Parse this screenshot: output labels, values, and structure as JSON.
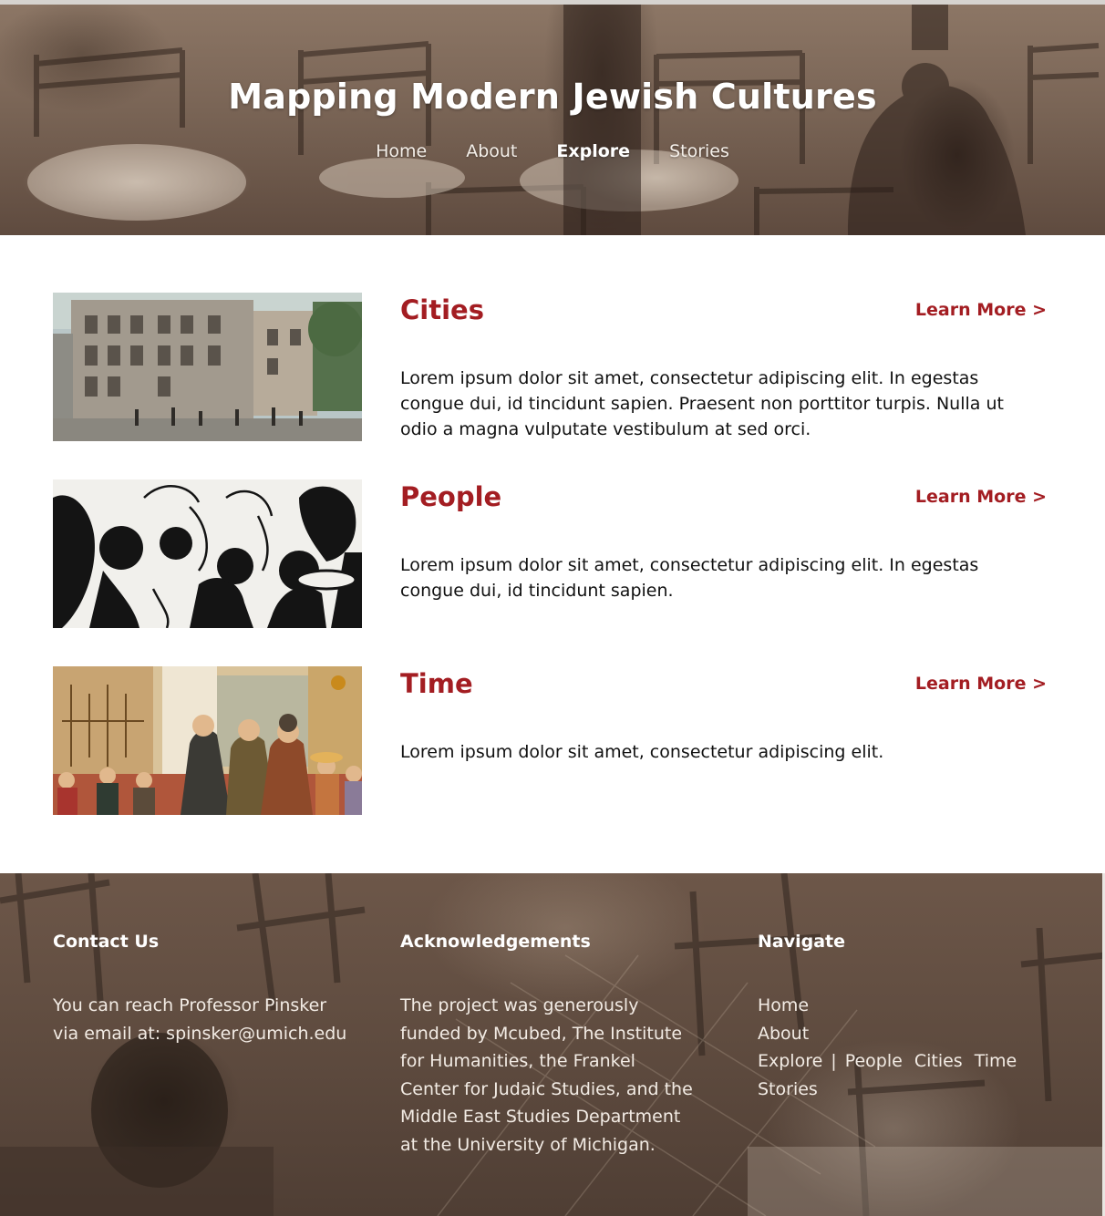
{
  "site": {
    "title": "Mapping Modern Jewish Cultures",
    "nav": [
      {
        "label": "Home",
        "active": false
      },
      {
        "label": "About",
        "active": false
      },
      {
        "label": "Explore",
        "active": true
      },
      {
        "label": "Stories",
        "active": false
      }
    ]
  },
  "colors": {
    "accent": "#a31d22",
    "hero_tone": "#7a6556",
    "footer_tone": "#5d4a3e"
  },
  "sections": [
    {
      "title": "Cities",
      "learn_more": "Learn More >",
      "image": "city-street-postcard",
      "text": "Lorem ipsum dolor sit amet, consectetur adipiscing elit. In egestas congue dui, id tincidunt sapien. Praesent non porttitor turpis. Nulla ut odio a magna vulputate vestibulum at sed orci."
    },
    {
      "title": "People",
      "learn_more": "Learn More >",
      "image": "people-crowd-ink-drawing",
      "text": "Lorem ipsum dolor sit amet, consectetur adipiscing elit. In egestas congue dui, id tincidunt sapien."
    },
    {
      "title": "Time",
      "learn_more": "Learn More >",
      "image": "cafe-scene-color-illustration",
      "text": "Lorem ipsum dolor sit amet, consectetur adipiscing elit."
    }
  ],
  "footer": {
    "contact": {
      "heading": "Contact Us",
      "line1": "You can reach Professor Pinsker",
      "line2": "via email at: spinsker@umich.edu"
    },
    "acknowledgements": {
      "heading": "Acknowledgements",
      "lines": [
        "The project was generously",
        "funded by Mcubed, The Institute",
        "for Humanities, the Frankel",
        "Center for Judaic Studies, and the",
        "Middle East Studies Department",
        "at the University of Michigan."
      ]
    },
    "navigate": {
      "heading": "Navigate",
      "home": "Home",
      "about": "About",
      "explore": "Explore",
      "separator": "|",
      "people": "People",
      "cities": "Cities",
      "time": "Time",
      "stories": "Stories"
    }
  }
}
